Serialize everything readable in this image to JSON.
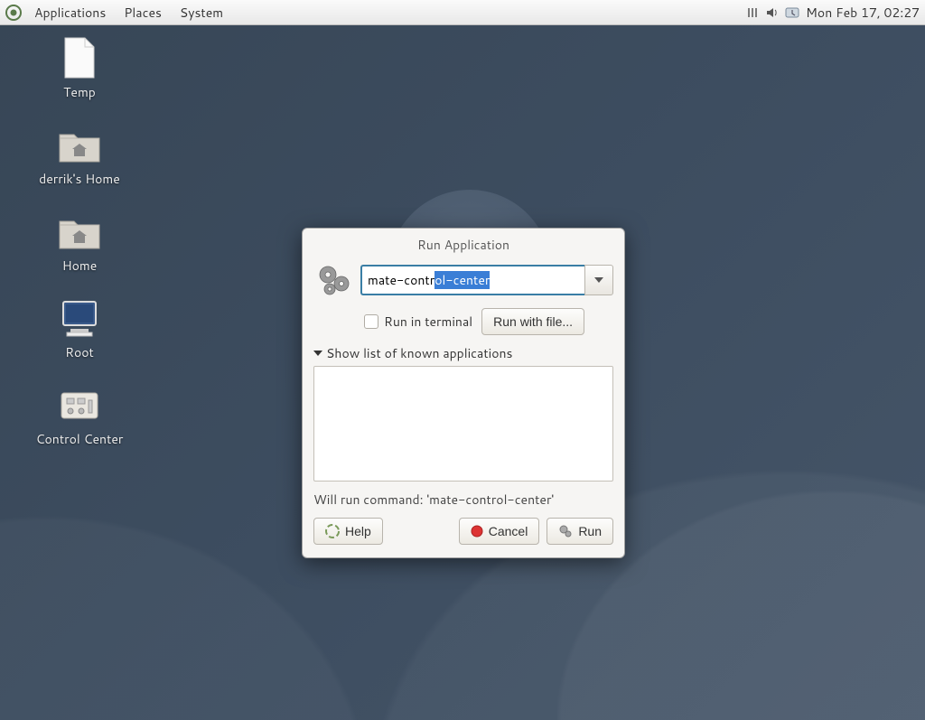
{
  "panel": {
    "menus": [
      "Applications",
      "Places",
      "System"
    ],
    "clock": "Mon Feb 17, 02:27"
  },
  "desktop_icons": [
    {
      "label": "Temp",
      "kind": "file"
    },
    {
      "label": "derrik's Home",
      "kind": "folder"
    },
    {
      "label": "Home",
      "kind": "folder"
    },
    {
      "label": "Root",
      "kind": "computer"
    },
    {
      "label": "Control Center",
      "kind": "control"
    }
  ],
  "dialog": {
    "title": "Run Application",
    "command_typed": "mate-contr",
    "command_selected": "ol-center",
    "run_in_terminal_label": "Run in terminal",
    "run_in_terminal_checked": false,
    "run_with_file_label": "Run with file...",
    "expander_label": "Show list of known applications",
    "will_run_label": "Will run command: 'mate-control-center'",
    "buttons": {
      "help": "Help",
      "cancel": "Cancel",
      "run": "Run"
    }
  }
}
